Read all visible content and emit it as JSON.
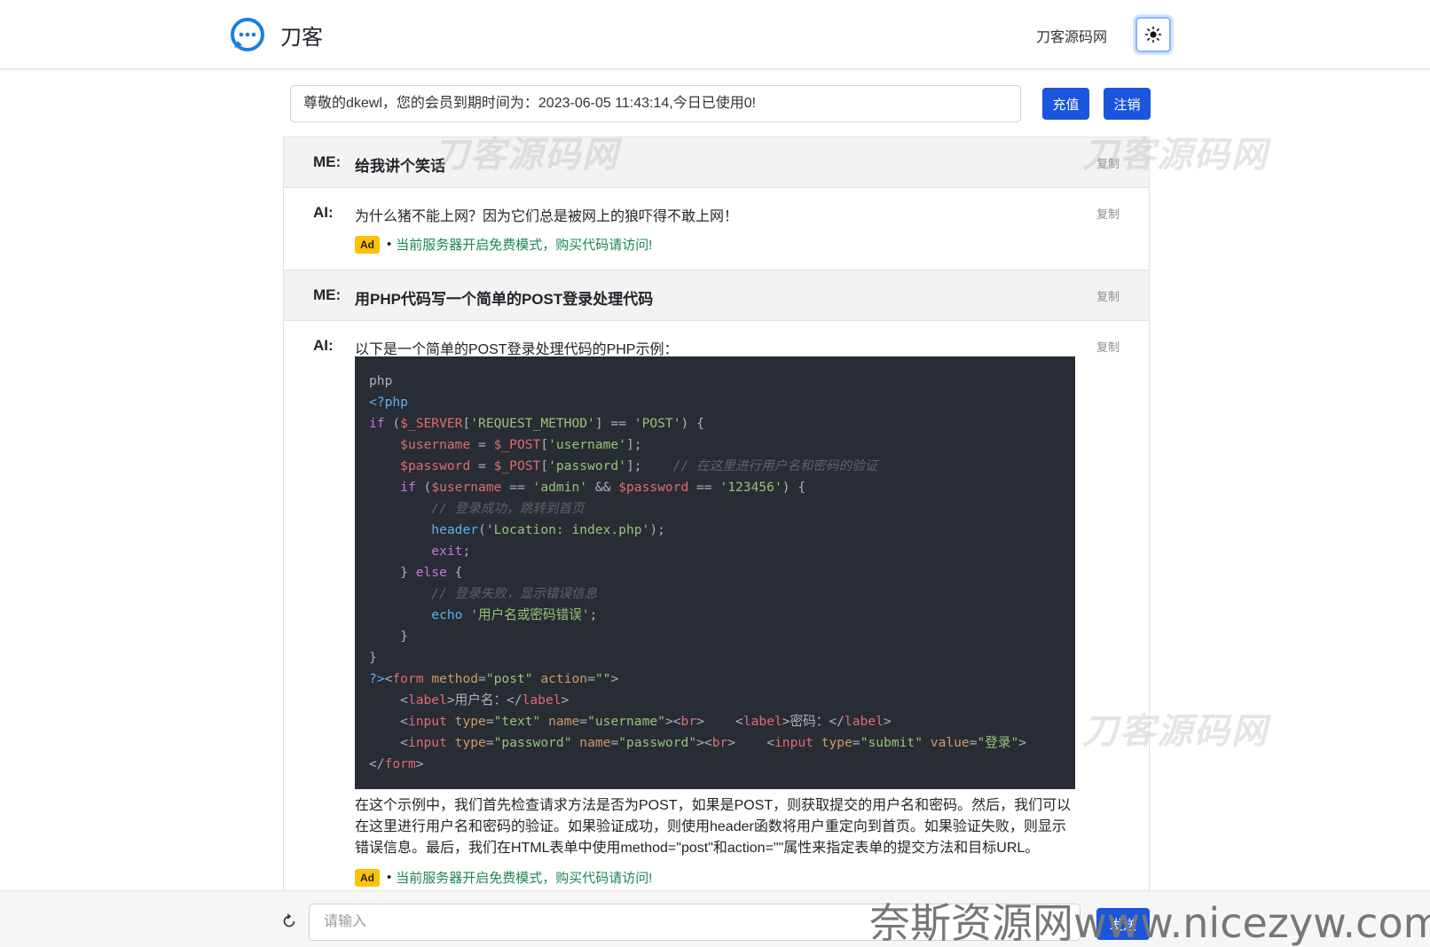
{
  "navbar": {
    "brand": "刀客",
    "link": "刀客源码网",
    "theme_icon": "sun-icon"
  },
  "member": {
    "info": "尊敬的dkewl，您的会员到期时间为：2023-06-05 11:43:14,今日已使用0!",
    "recharge_label": "充值",
    "logout_label": "注销"
  },
  "messages": {
    "q1": {
      "who": "ME:",
      "text": "给我讲个笑话",
      "copy": "复制"
    },
    "a1": {
      "who": "AI:",
      "text": "为什么猪不能上网？因为它们总是被网上的狼吓得不敢上网！",
      "copy": "复制"
    },
    "q2": {
      "who": "ME:",
      "text": "用PHP代码写一个简单的POST登录处理代码",
      "copy": "复制"
    },
    "a2": {
      "who": "AI:",
      "intro": "以下是一个简单的POST登录处理代码的PHP示例：",
      "copy": "复制",
      "explain": "在这个示例中，我们首先检查请求方法是否为POST，如果是POST，则获取提交的用户名和密码。然后，我们可以在这里进行用户名和密码的验证。如果验证成功，则使用header函数将用户重定向到首页。如果验证失败，则显示错误信息。最后，我们在HTML表单中使用method=\"post\"和action=\"\"属性来指定表单的提交方法和目标URL。"
    }
  },
  "ad": {
    "badge": "Ad",
    "dot": "•",
    "text": "当前服务器开启免费模式，购买代码请访问!"
  },
  "watermark": "刀客源码网",
  "footer": {
    "placeholder": "请输入",
    "send_label": "发送",
    "watermark": "奈斯资源网www.nicezyw.com"
  },
  "colors": {
    "primary": "#1a56db",
    "ad_green": "#198754",
    "ad_badge": "#ffc107",
    "code_bg": "#282c34"
  }
}
